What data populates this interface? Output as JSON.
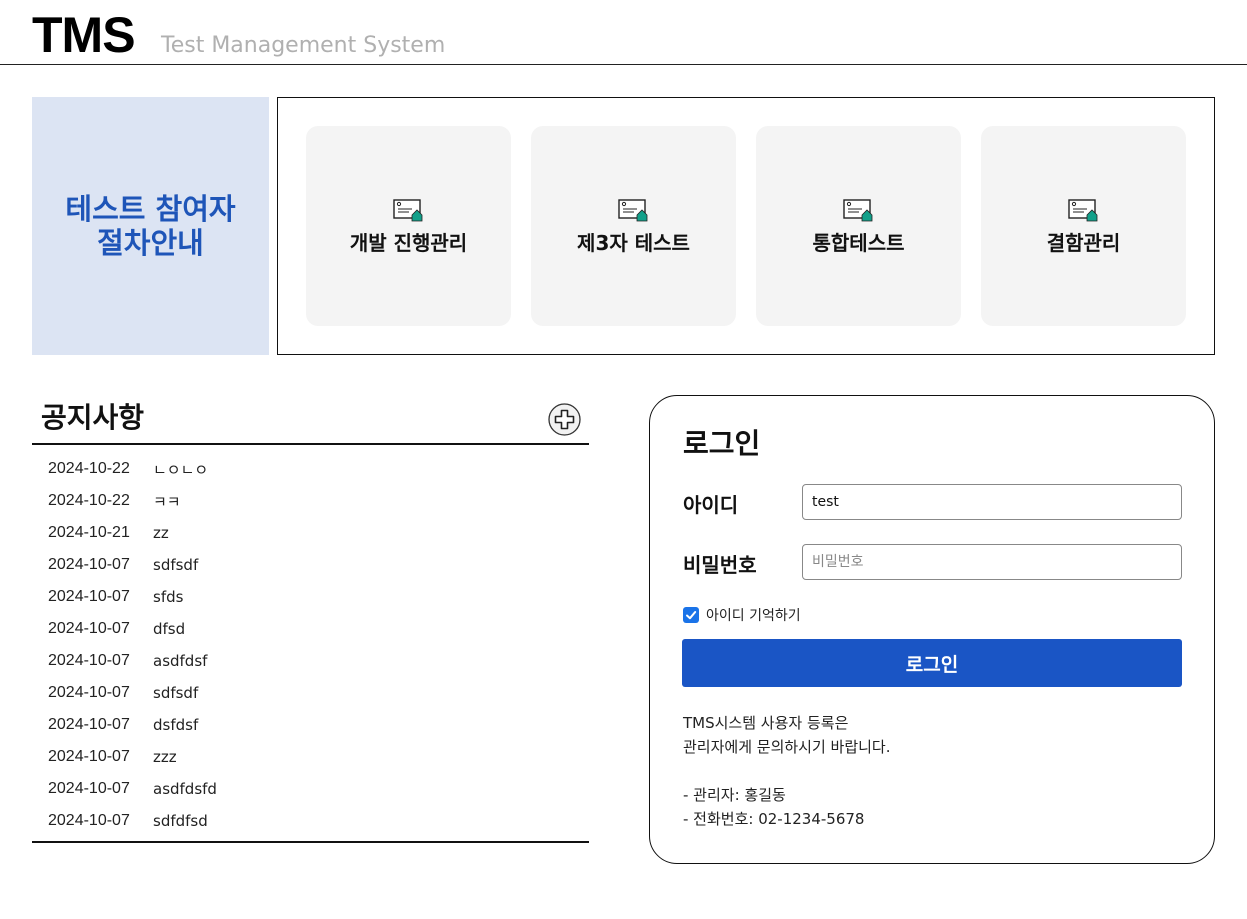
{
  "header": {
    "logo": "TMS",
    "subtitle": "Test Management System"
  },
  "guide": {
    "title": "테스트 참여자\n절차안내"
  },
  "menu": [
    {
      "label": "개발 진행관리",
      "icon": "document-icon"
    },
    {
      "label": "제3자 테스트",
      "icon": "document-icon"
    },
    {
      "label": "통합테스트",
      "icon": "document-icon"
    },
    {
      "label": "결함관리",
      "icon": "document-icon"
    }
  ],
  "notices": {
    "title": "공지사항",
    "items": [
      {
        "date": "2024-10-22",
        "title": "ㄴㅇㄴㅇ"
      },
      {
        "date": "2024-10-22",
        "title": "ㅋㅋ"
      },
      {
        "date": "2024-10-21",
        "title": "zz"
      },
      {
        "date": "2024-10-07",
        "title": "sdfsdf"
      },
      {
        "date": "2024-10-07",
        "title": "sfds"
      },
      {
        "date": "2024-10-07",
        "title": "dfsd"
      },
      {
        "date": "2024-10-07",
        "title": "asdfdsf"
      },
      {
        "date": "2024-10-07",
        "title": "sdfsdf"
      },
      {
        "date": "2024-10-07",
        "title": "dsfdsf"
      },
      {
        "date": "2024-10-07",
        "title": "zzz"
      },
      {
        "date": "2024-10-07",
        "title": "asdfdsfd"
      },
      {
        "date": "2024-10-07",
        "title": "sdfdfsd"
      }
    ]
  },
  "login": {
    "title": "로그인",
    "id_label": "아이디",
    "id_value": "test",
    "pw_label": "비밀번호",
    "pw_placeholder": "비밀번호",
    "remember_label": "아이디 기억하기",
    "remember_checked": true,
    "button_label": "로그인",
    "info_lines": [
      "TMS시스템 사용자 등록은",
      "관리자에게 문의하시기 바랍니다.",
      "",
      "- 관리자: 홍길동",
      "- 전화번호: 02-1234-5678"
    ]
  },
  "colors": {
    "accent": "#1a55c5",
    "guide_bg": "#dce4f3",
    "guide_text": "#1e55b8",
    "card_bg": "#f4f4f4",
    "icon_teal": "#12a08a"
  }
}
